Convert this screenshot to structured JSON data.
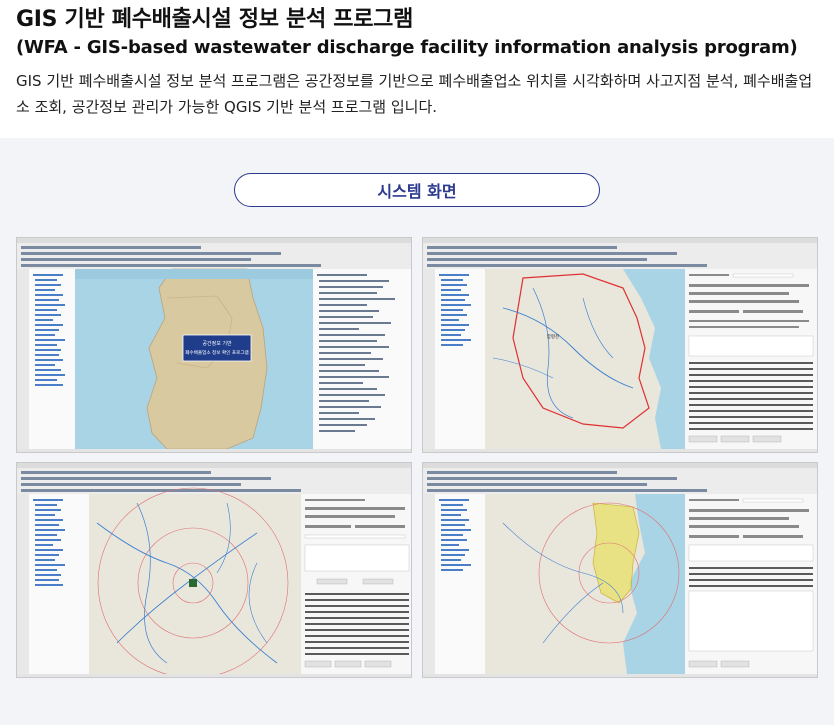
{
  "header": {
    "title": "GIS 기반 폐수배출시설 정보 분석 프로그램",
    "subtitle": "(WFA - GIS-based wastewater discharge facility information analysis program)",
    "description": "GIS 기반 폐수배출시설 정보 분석 프로그램은 공간정보를 기반으로 폐수배출업소 위치를 시각화하며 사고지점 분석, 폐수배출업소 조회, 공간정보 관리가 가능한 QGIS 기반 분석 프로그램 입니다."
  },
  "gallery": {
    "section_label": "시스템 화면",
    "screenshots": [
      {
        "map": "korea",
        "popup_line1": "공간정보 기반",
        "popup_line2": "폐수배출업소 정보 확인 프로그램"
      },
      {
        "map": "watershed",
        "place_label": "함평천"
      },
      {
        "map": "rivers"
      },
      {
        "map": "coast"
      }
    ]
  },
  "colors": {
    "accent": "#2b3a8f",
    "sea": "#a8d4e6",
    "land": "#e9e6dc",
    "korea_land": "#d9c9a0",
    "boundary": "#e03030",
    "highlight": "#e8e060",
    "river": "#3a7fd0",
    "toolbar": "#ececec"
  }
}
